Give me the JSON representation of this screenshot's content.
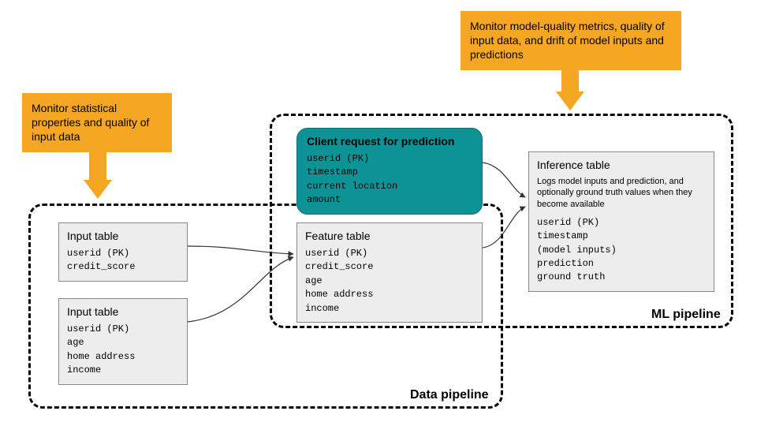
{
  "callouts": {
    "left": "Monitor statistical properties and quality of input data",
    "right": "Monitor model-quality metrics, quality of input data, and drift of model inputs and predictions"
  },
  "pipelines": {
    "data_label": "Data pipeline",
    "ml_label": "ML pipeline"
  },
  "input_table_1": {
    "title": "Input table",
    "fields": "userid (PK)\ncredit_score"
  },
  "input_table_2": {
    "title": "Input table",
    "fields": "userid (PK)\nage\nhome address\nincome"
  },
  "feature_table": {
    "title": "Feature table",
    "fields": "userid (PK)\ncredit_score\nage\nhome address\nincome"
  },
  "client_request": {
    "title": "Client request for prediction",
    "fields": "userid (PK)\ntimestamp\ncurrent location\namount"
  },
  "inference_table": {
    "title": "Inference table",
    "desc": "Logs model inputs and prediction, and optionally ground truth values when they become available",
    "fields": "userid (PK)\ntimestamp\n(model inputs)\nprediction\nground truth"
  }
}
